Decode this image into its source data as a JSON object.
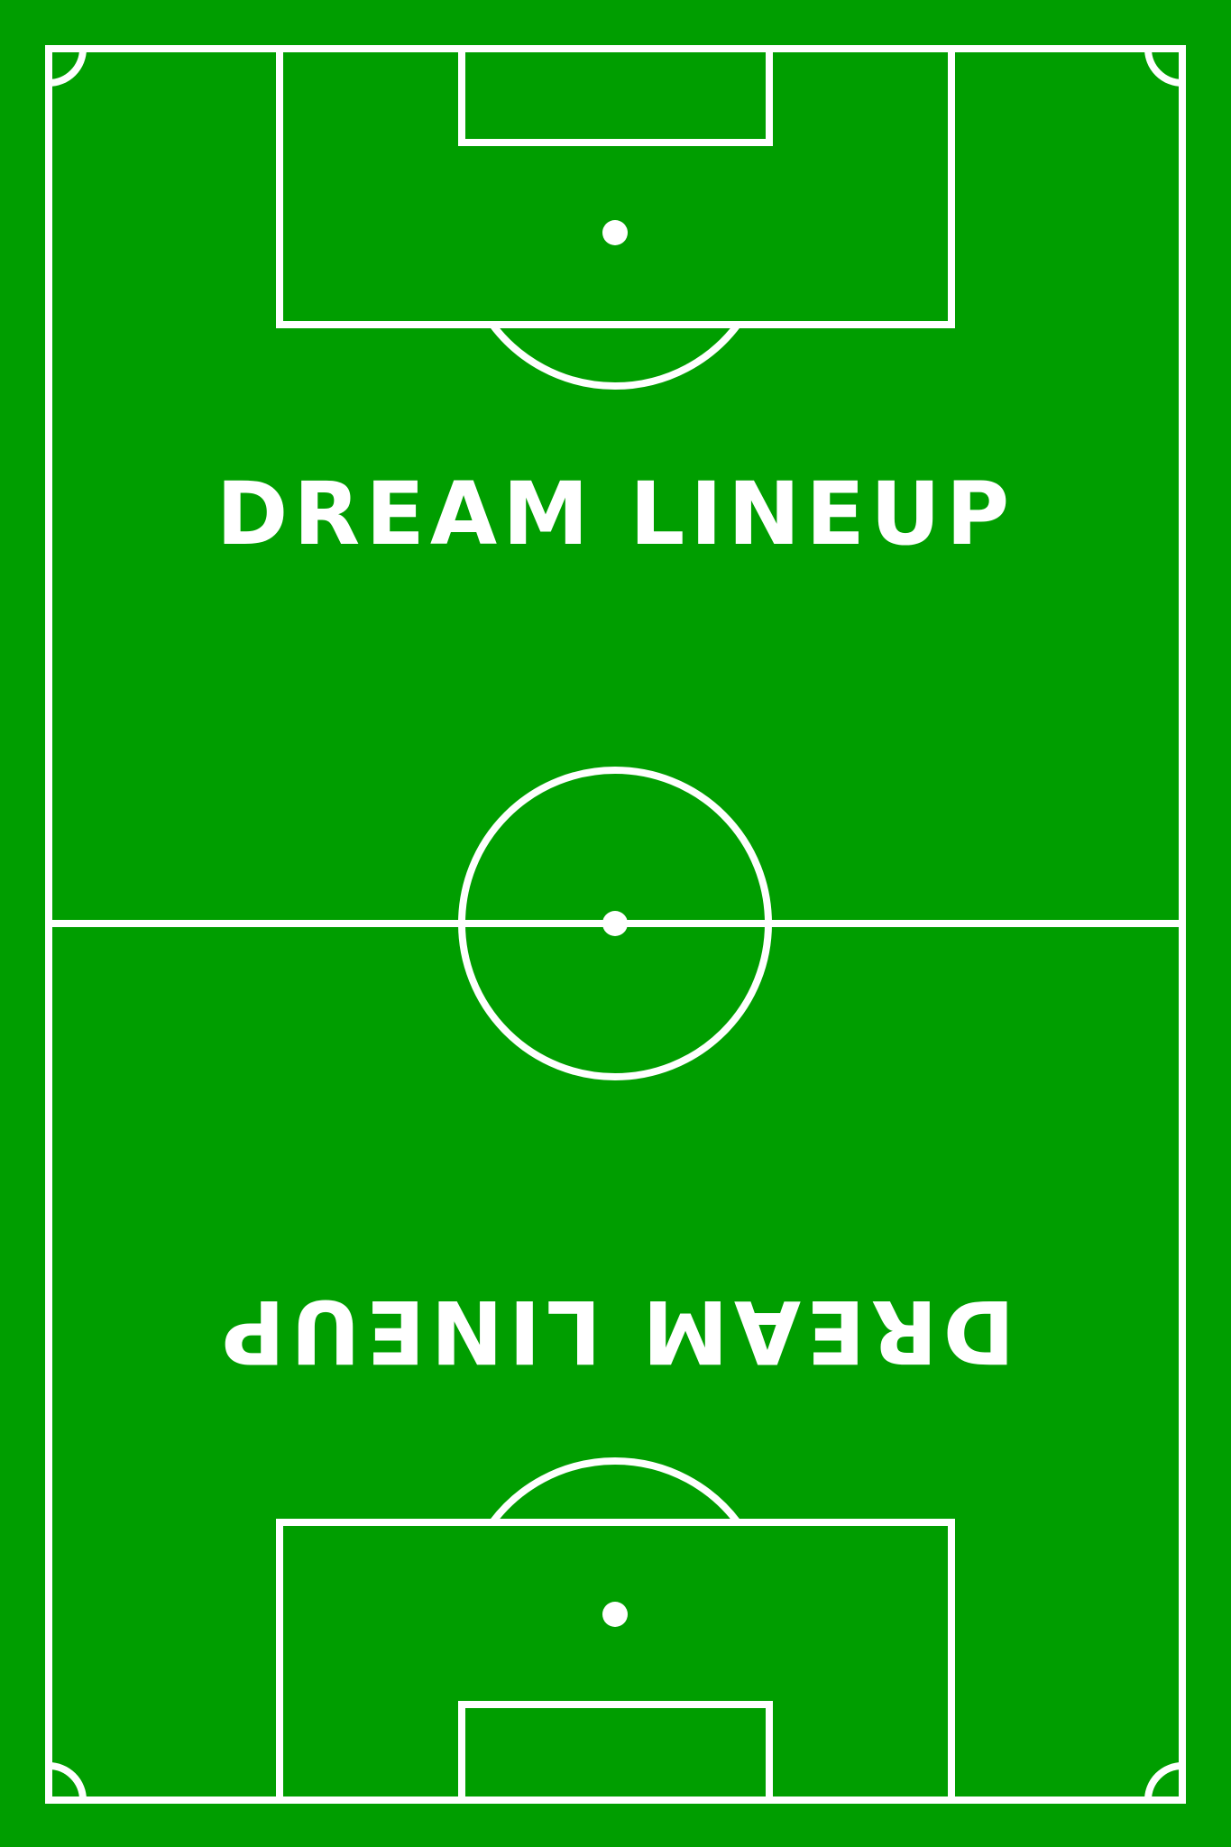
{
  "colors": {
    "field": "#009e00",
    "lines": "#ffffff"
  },
  "titles": {
    "top": "DREAM LINEUP",
    "bottom": "DREAM LINEUP"
  }
}
